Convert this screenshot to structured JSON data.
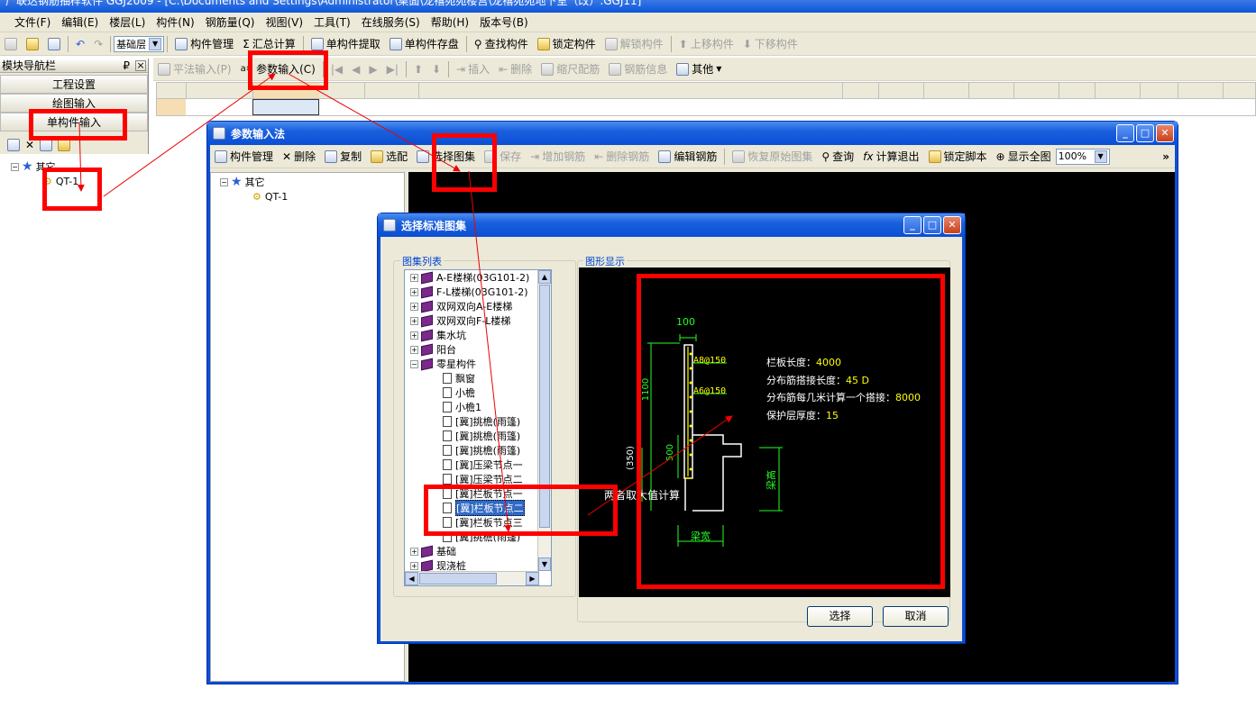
{
  "app_title": "广联达钢筋抽样软件 GGJ2009 - [C:\\Documents and Settings\\Administrator\\桌面\\龙禧苑苑楼宫\\龙禧苑苑地下室（改）.GGJ11]",
  "menu": [
    "文件(F)",
    "编辑(E)",
    "楼层(L)",
    "构件(N)",
    "钢筋量(Q)",
    "视图(V)",
    "工具(T)",
    "在线服务(S)",
    "帮助(H)",
    "版本号(B)"
  ],
  "toolbar1": {
    "floor": "基础层",
    "items": [
      "构件管理",
      "汇总计算",
      "单构件提取",
      "单构件存盘",
      "查找构件",
      "锁定构件",
      "解锁构件",
      "上移构件",
      "下移构件"
    ]
  },
  "toolbar2": {
    "items": [
      "平法输入(P)",
      "参数输入(C)",
      "插入",
      "删除",
      "缩尺配筋",
      "钢筋信息",
      "其他"
    ]
  },
  "nav": {
    "title": "模块导航栏",
    "pin": "₽",
    "close": "×",
    "buttons": [
      "工程设置",
      "绘图输入",
      "单构件输入"
    ],
    "tree_root": "其它",
    "tree_child": "QT-1"
  },
  "param_win": {
    "title": "参数输入法",
    "toolbar": [
      "构件管理",
      "删除",
      "复制",
      "选配",
      "选择图集",
      "保存",
      "增加钢筋",
      "删除钢筋",
      "编辑钢筋",
      "恢复原始图集",
      "查询",
      "计算退出",
      "锁定脚本",
      "显示全图"
    ],
    "zoom": "100%",
    "tree_root": "其它",
    "tree_child": "QT-1"
  },
  "select_win": {
    "title": "选择标准图集",
    "list_label": "图集列表",
    "preview_label": "图形显示",
    "books": [
      "A-E楼梯(03G101-2)",
      "F-L楼梯(03G101-2)",
      "双网双向A-E楼梯",
      "双网双向F-L楼梯",
      "集水坑",
      "阳台",
      "零星构件"
    ],
    "docs": [
      "飘窗",
      "小檐",
      "小檐1",
      "[冀]挑檐(雨篷)",
      "[冀]挑檐(雨篷)",
      "[冀]挑檐(雨篷)",
      "[冀]压梁节点一",
      "[冀]压梁节点二",
      "[冀]栏板节点一",
      "[冀]栏板节点二",
      "[冀]栏板节点三",
      "[冀]挑檐(雨篷)"
    ],
    "after": [
      "基础",
      "现浇桩"
    ],
    "selected_index": 9,
    "ok": "选择",
    "cancel": "取消"
  },
  "cad": {
    "dim_top": "100",
    "rebar1": "A8@150",
    "rebar2": "A6@150",
    "dim_h": "1100",
    "dim_500": "500",
    "dim_350": "(350)",
    "note": "两者取大值计算",
    "beam_h": "梁高",
    "beam_w": "梁宽",
    "params": [
      {
        "label": "栏板长度：",
        "value": "4000"
      },
      {
        "label": "分布筋搭接长度：",
        "value": "45 D"
      },
      {
        "label": "分布筋每几米计算一个搭接：",
        "value": "8000"
      },
      {
        "label": "保护层厚度：",
        "value": "15"
      }
    ]
  },
  "colors": {
    "highlight": "#ff0000",
    "cad_bg": "#000000",
    "cad_green": "#22ff22",
    "cad_yellow": "#ffff00",
    "xp_blue": "#0a4fd4"
  }
}
